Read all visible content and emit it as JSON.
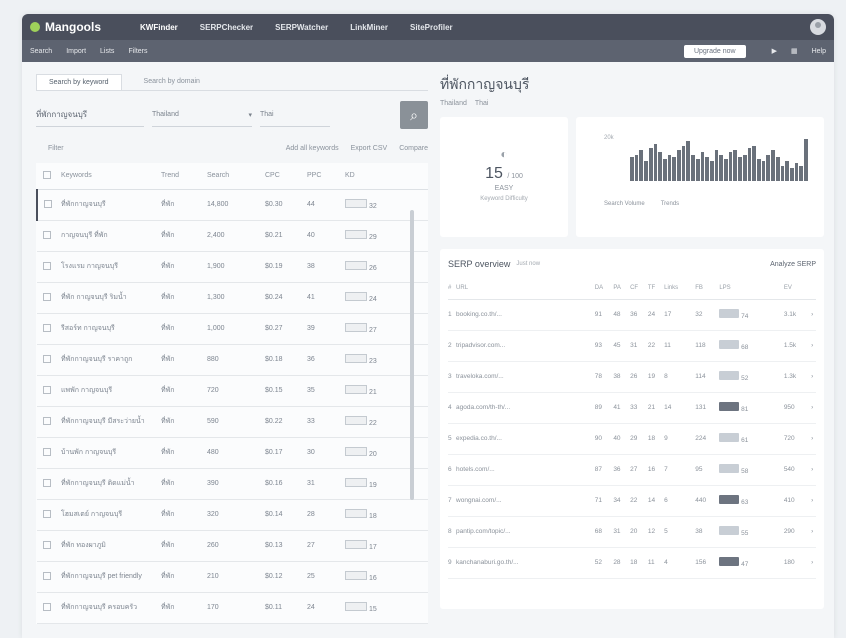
{
  "app": {
    "logo": "Mangools",
    "nav": [
      "KWFinder",
      "SERPChecker",
      "SERPWatcher",
      "LinkMiner",
      "SiteProfiler"
    ],
    "active_nav": 0
  },
  "subbar": {
    "links": [
      "Search",
      "Import",
      "Lists",
      "Filters"
    ],
    "upgrade_label": "Upgrade now",
    "help_label": "Help"
  },
  "tabs": [
    "Search by keyword",
    "Search by domain"
  ],
  "search": {
    "seed": "ที่พักกาญจนบุรี",
    "location": "Thailand",
    "language": "Thai",
    "go_icon": "search"
  },
  "filters": {
    "label": "Filter",
    "add_keyword": "Add all keywords",
    "export": "Export CSV",
    "compare": "Compare"
  },
  "keyword_table": {
    "headers": [
      "Keywords",
      "Trend",
      "Search",
      "CPC",
      "PPC",
      "KD"
    ],
    "rows": [
      {
        "kw": "ที่พักกาญจนบุรี",
        "trend": "ที่พัก",
        "search": "14,800",
        "cpc": "$0.30",
        "ppc": "44",
        "kd": "32",
        "selected": true
      },
      {
        "kw": "กาญจนบุรี ที่พัก",
        "trend": "ที่พัก",
        "search": "2,400",
        "cpc": "$0.21",
        "ppc": "40",
        "kd": "29",
        "selected": false
      },
      {
        "kw": "โรงแรม กาญจนบุรี",
        "trend": "ที่พัก",
        "search": "1,900",
        "cpc": "$0.19",
        "ppc": "38",
        "kd": "26",
        "selected": false
      },
      {
        "kw": "ที่พัก กาญจนบุรี ริมน้ำ",
        "trend": "ที่พัก",
        "search": "1,300",
        "cpc": "$0.24",
        "ppc": "41",
        "kd": "24",
        "selected": false
      },
      {
        "kw": "รีสอร์ท กาญจนบุรี",
        "trend": "ที่พัก",
        "search": "1,000",
        "cpc": "$0.27",
        "ppc": "39",
        "kd": "27",
        "selected": false
      },
      {
        "kw": "ที่พักกาญจนบุรี ราคาถูก",
        "trend": "ที่พัก",
        "search": "880",
        "cpc": "$0.18",
        "ppc": "36",
        "kd": "23",
        "selected": false
      },
      {
        "kw": "แพพัก กาญจนบุรี",
        "trend": "ที่พัก",
        "search": "720",
        "cpc": "$0.15",
        "ppc": "35",
        "kd": "21",
        "selected": false
      },
      {
        "kw": "ที่พักกาญจนบุรี มีสระว่ายน้ำ",
        "trend": "ที่พัก",
        "search": "590",
        "cpc": "$0.22",
        "ppc": "33",
        "kd": "22",
        "selected": false
      },
      {
        "kw": "บ้านพัก กาญจนบุรี",
        "trend": "ที่พัก",
        "search": "480",
        "cpc": "$0.17",
        "ppc": "30",
        "kd": "20",
        "selected": false
      },
      {
        "kw": "ที่พักกาญจนบุรี ติดแม่น้ำ",
        "trend": "ที่พัก",
        "search": "390",
        "cpc": "$0.16",
        "ppc": "31",
        "kd": "19",
        "selected": false
      },
      {
        "kw": "โฮมสเตย์ กาญจนบุรี",
        "trend": "ที่พัก",
        "search": "320",
        "cpc": "$0.14",
        "ppc": "28",
        "kd": "18",
        "selected": false
      },
      {
        "kw": "ที่พัก ทองผาภูมิ",
        "trend": "ที่พัก",
        "search": "260",
        "cpc": "$0.13",
        "ppc": "27",
        "kd": "17",
        "selected": false
      },
      {
        "kw": "ที่พักกาญจนบุรี pet friendly",
        "trend": "ที่พัก",
        "search": "210",
        "cpc": "$0.12",
        "ppc": "25",
        "kd": "16",
        "selected": false
      },
      {
        "kw": "ที่พักกาญจนบุรี ครอบครัว",
        "trend": "ที่พัก",
        "search": "170",
        "cpc": "$0.11",
        "ppc": "24",
        "kd": "15",
        "selected": false
      }
    ]
  },
  "detail": {
    "keyword": "ที่พักกาญจนบุรี",
    "location": "Thailand",
    "language": "Thai",
    "kd_value": "15",
    "kd_max": "/ 100",
    "kd_label": "EASY",
    "kd_sub": "Keyword Difficulty",
    "search_volume_label": "Search Volume",
    "trend_label": "Trends",
    "chart_ymax": "20k",
    "bars": [
      0.55,
      0.6,
      0.7,
      0.45,
      0.75,
      0.85,
      0.65,
      0.5,
      0.6,
      0.55,
      0.7,
      0.8,
      0.9,
      0.6,
      0.5,
      0.65,
      0.55,
      0.45,
      0.7,
      0.6,
      0.5,
      0.65,
      0.7,
      0.55,
      0.6,
      0.75,
      0.8,
      0.5,
      0.45,
      0.6,
      0.7,
      0.55,
      0.35,
      0.45,
      0.3,
      0.4,
      0.35,
      0.95
    ]
  },
  "serp": {
    "title": "SERP overview",
    "subtitle": "Just now",
    "analyze": "Analyze SERP",
    "headers": [
      "#",
      "URL",
      "DA",
      "PA",
      "CF",
      "TF",
      "Links",
      "FB",
      "LPS",
      "EV",
      ""
    ],
    "rows": [
      {
        "pos": "1",
        "url": "booking.co.th/...",
        "da": "91",
        "pa": "48",
        "cf": "36",
        "tf": "24",
        "links": "17",
        "fb": "32",
        "lps": "74",
        "ev": "3.1k",
        "dark": false
      },
      {
        "pos": "2",
        "url": "tripadvisor.com...",
        "da": "93",
        "pa": "45",
        "cf": "31",
        "tf": "22",
        "links": "11",
        "fb": "118",
        "lps": "68",
        "ev": "1.5k",
        "dark": false
      },
      {
        "pos": "3",
        "url": "traveloka.com/...",
        "da": "78",
        "pa": "38",
        "cf": "26",
        "tf": "19",
        "links": "8",
        "fb": "114",
        "lps": "52",
        "ev": "1.3k",
        "dark": false
      },
      {
        "pos": "4",
        "url": "agoda.com/th-th/...",
        "da": "89",
        "pa": "41",
        "cf": "33",
        "tf": "21",
        "links": "14",
        "fb": "131",
        "lps": "81",
        "ev": "950",
        "dark": true
      },
      {
        "pos": "5",
        "url": "expedia.co.th/...",
        "da": "90",
        "pa": "40",
        "cf": "29",
        "tf": "18",
        "links": "9",
        "fb": "224",
        "lps": "61",
        "ev": "720",
        "dark": false
      },
      {
        "pos": "6",
        "url": "hotels.com/...",
        "da": "87",
        "pa": "36",
        "cf": "27",
        "tf": "16",
        "links": "7",
        "fb": "95",
        "lps": "58",
        "ev": "540",
        "dark": false
      },
      {
        "pos": "7",
        "url": "wongnai.com/...",
        "da": "71",
        "pa": "34",
        "cf": "22",
        "tf": "14",
        "links": "6",
        "fb": "440",
        "lps": "63",
        "ev": "410",
        "dark": true
      },
      {
        "pos": "8",
        "url": "pantip.com/topic/...",
        "da": "68",
        "pa": "31",
        "cf": "20",
        "tf": "12",
        "links": "5",
        "fb": "38",
        "lps": "55",
        "ev": "290",
        "dark": false
      },
      {
        "pos": "9",
        "url": "kanchanaburi.go.th/...",
        "da": "52",
        "pa": "28",
        "cf": "18",
        "tf": "11",
        "links": "4",
        "fb": "156",
        "lps": "47",
        "ev": "180",
        "dark": true
      }
    ]
  }
}
